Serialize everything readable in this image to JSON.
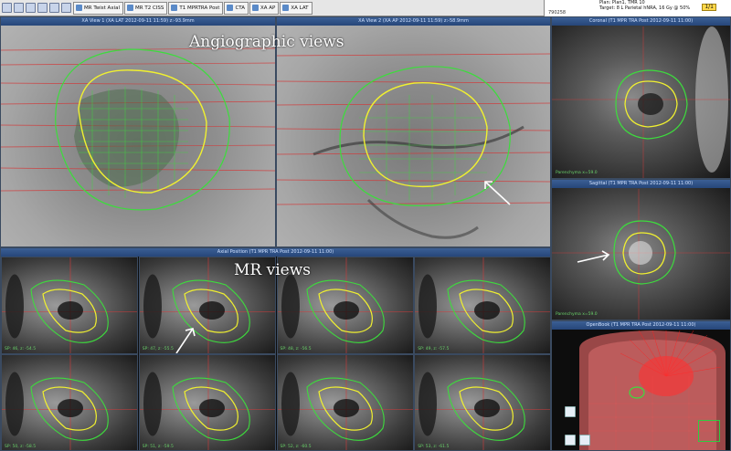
{
  "toolbar": {
    "tabs": [
      {
        "label": "MR Twist Axial"
      },
      {
        "label": "MR T2 CISS"
      },
      {
        "label": "T1 MPRTRA Post"
      },
      {
        "label": "CTA"
      },
      {
        "label": "XA AP"
      },
      {
        "label": "XA LAT"
      }
    ],
    "plan_info": {
      "line1": "Plan: Plan1, TMR 10",
      "line2": "Target: 8 L Parietal hNRA, 16 Gy @ 50%",
      "page": "1/1",
      "id": "790258"
    }
  },
  "panels": {
    "angio_lat": {
      "title": "XA View 1 (XA LAT 2012-09-11 11:59) z:-93.9mm"
    },
    "angio_ap": {
      "title": "XA View 2 (XA AP 2012-09-11 11:59) z:-58.9mm"
    },
    "coronal": {
      "title": "Coronal (T1 MPR TRA Post 2012-09-11 11:00)",
      "bottom_label": "Parenchyma x=59.0"
    },
    "sagittal": {
      "title": "Sagittal (T1 MPR TRA Post 2012-09-11 11:00)",
      "bottom_label": "Parenchyma x=59.0"
    },
    "axial": {
      "title": "Axial Position (T1 MPR TRA Post 2012-09-11 11:00)"
    },
    "overview": {
      "title": "OpenBook (T1 MPR TRA Post 2012-09-11 11:00)"
    }
  },
  "annotations": {
    "angio_title": "Angiographic views",
    "mr_title": "MR views"
  },
  "axial_tiles": [
    {
      "label": "SP: 46, z: -54.5"
    },
    {
      "label": "SP: 47, z: -55.5"
    },
    {
      "label": "SP: 48, z: -56.5"
    },
    {
      "label": "SP: 49, z: -57.5"
    },
    {
      "label": "SP: 50, z: -58.5"
    },
    {
      "label": "SP: 51, z: -59.5"
    },
    {
      "label": "SP: 52, z: -60.5"
    },
    {
      "label": "SP: 53, z: -61.5"
    }
  ],
  "colors": {
    "isodose_outer": "#3ddc3d",
    "isodose_target": "#f0f030",
    "grid": "#d23a3a",
    "title_bar": "#2d5189"
  },
  "icons": [
    "arrow-up-icon",
    "arrow-down-icon",
    "zoom-icon",
    "ruler-icon",
    "contour-icon",
    "layout-icon"
  ]
}
